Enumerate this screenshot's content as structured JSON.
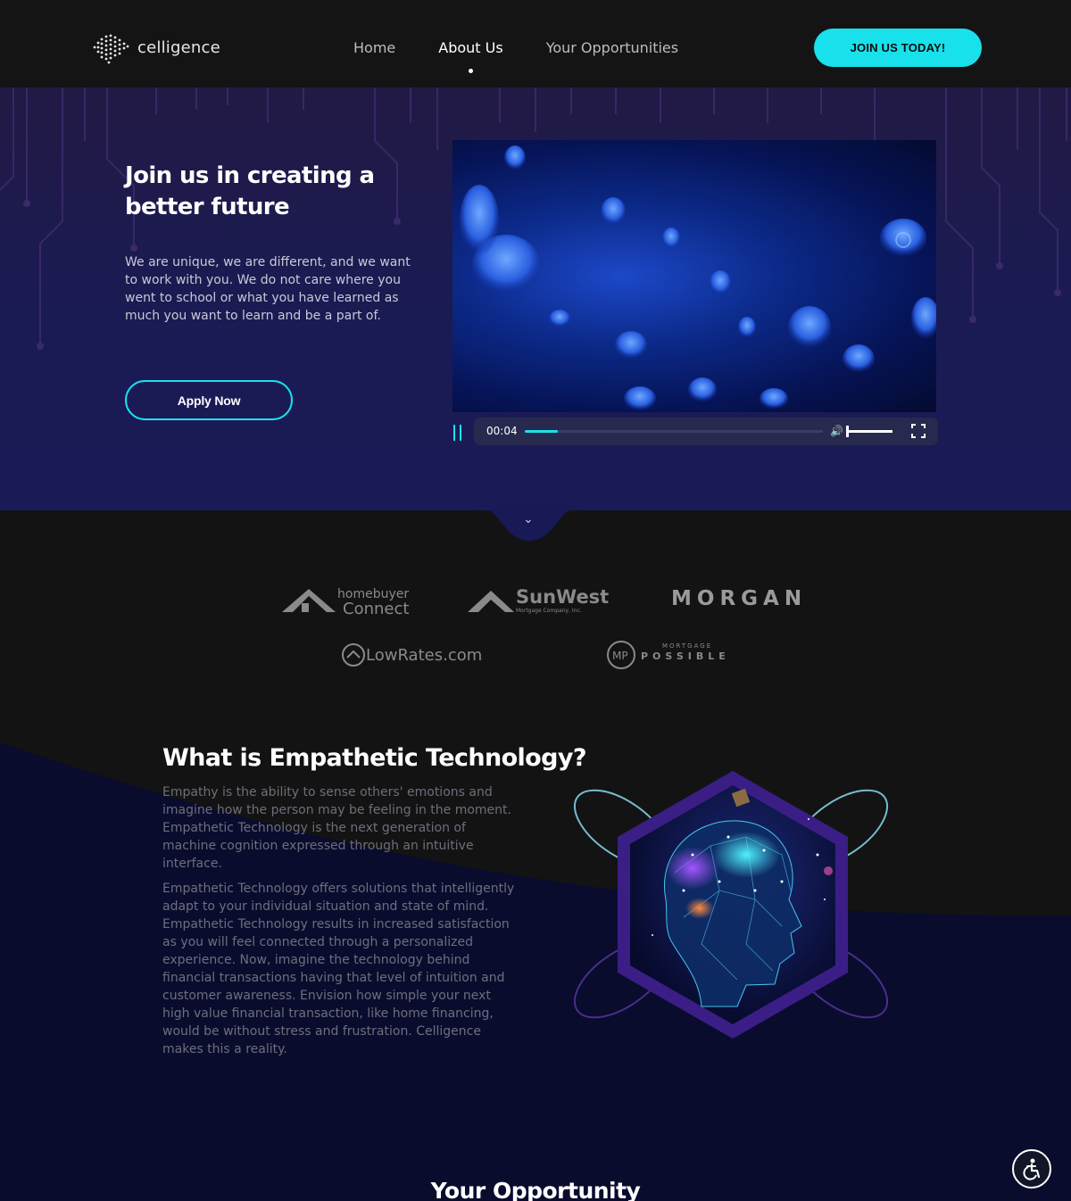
{
  "header": {
    "logo_text": "celligence",
    "nav": [
      {
        "label": "Home",
        "active": false
      },
      {
        "label": "About Us",
        "active": true
      },
      {
        "label": "Your Opportunities",
        "active": false
      }
    ],
    "cta_label": "JOIN US TODAY!"
  },
  "hero": {
    "title": "Join us in creating a better future",
    "text": "We are unique, we are different, and we want to work with you. We do not care where you went to school or what you have learned as much you want to learn and be a part of.",
    "apply_label": "Apply Now",
    "video": {
      "time": "00:04",
      "progress_fraction": 0.11,
      "volume_fraction": 1.0
    }
  },
  "partners": {
    "homebuyer_top": "homebuyer",
    "homebuyer_bottom": "Connect",
    "sunwest_name": "SunWest",
    "sunwest_sub": "Mortgage Company, Inc.",
    "morgan": "MORGAN",
    "lowrates": "LowRates.com",
    "mp_top": "MORTGAGE",
    "mp_bottom": "POSSIBLE"
  },
  "empathetic": {
    "title": "What is Empathetic Technology?",
    "p1": "Empathy is the ability to sense others' emotions and imagine how the person may be feeling in the moment. Empathetic Technology is the next generation of machine cognition expressed through an intuitive interface.",
    "p2": "Empathetic Technology offers solutions that intelligently adapt to your individual situation and state of mind. Empathetic Technology results in increased satisfaction as you will feel connected through a personalized experience. Now, imagine the technology behind financial transactions having that level of intuition and customer awareness. Envision how simple your next high value financial transaction, like home financing, would be without stress and frustration. Celligence makes this a reality."
  },
  "opportunity_title": "Your Opportunity",
  "colors": {
    "accent": "#19e1ec",
    "header_bg": "#141414",
    "hero_bg": "#1b1b52",
    "section_navy": "#0a0c2e",
    "hex_purple": "#3a1e86"
  },
  "icons": [
    "logo-mark-icon",
    "pause-icon",
    "volume-icon",
    "fullscreen-icon",
    "chevron-down-icon",
    "accessibility-icon"
  ]
}
